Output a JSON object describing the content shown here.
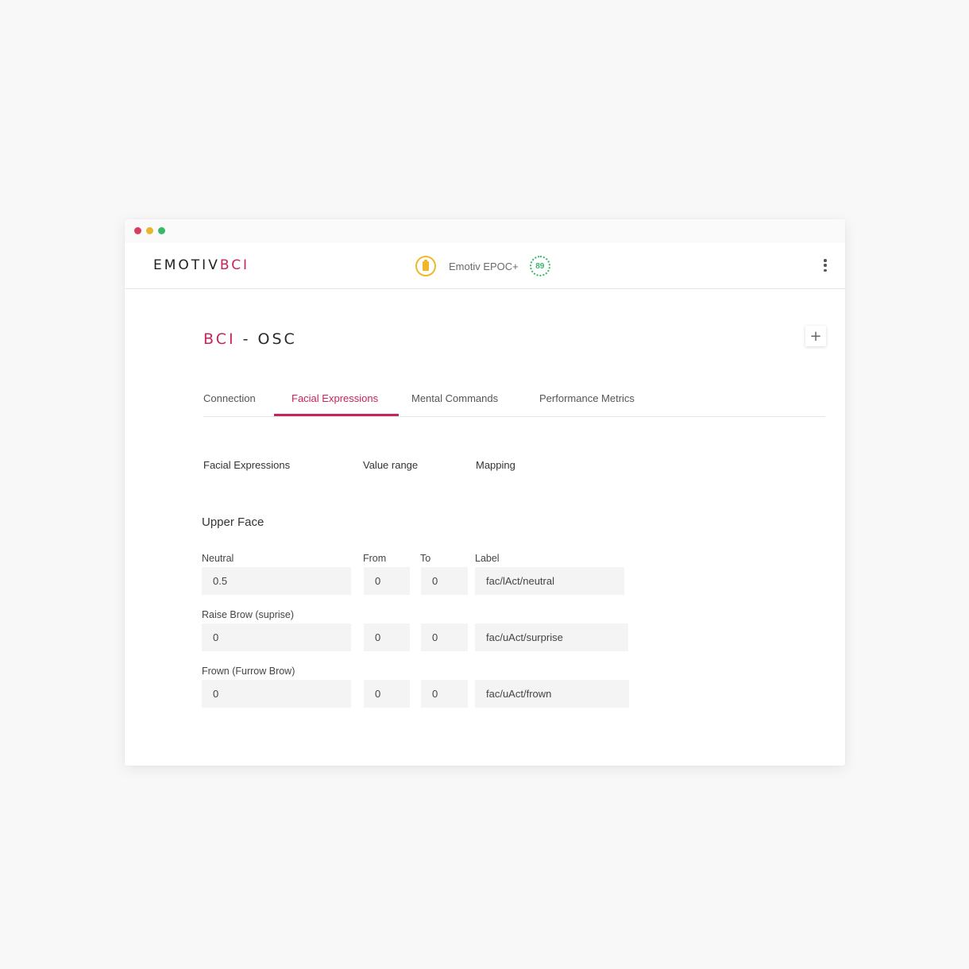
{
  "header": {
    "logo_main": "EMOTIV",
    "logo_accent": "BCI",
    "device_name": "Emotiv EPOC+",
    "signal_value": "89"
  },
  "page": {
    "title_accent": "BCI",
    "title_rest": " - OSC",
    "add_label": "+"
  },
  "tabs": [
    {
      "label": "Connection"
    },
    {
      "label": "Facial Expressions"
    },
    {
      "label": "Mental Commands"
    },
    {
      "label": "Performance Metrics"
    }
  ],
  "columns": {
    "expressions": "Facial Expressions",
    "value_range": "Value range",
    "mapping": "Mapping"
  },
  "section": {
    "title": "Upper Face",
    "from_label": "From",
    "to_label": "To",
    "label_label": "Label",
    "rows": [
      {
        "name": "Neutral",
        "value": "0.5",
        "from": "0",
        "to": "0",
        "label": "fac/lAct/neutral"
      },
      {
        "name": "Raise Brow (suprise)",
        "value": "0",
        "from": "0",
        "to": "0",
        "label": "fac/uAct/surprise"
      },
      {
        "name": "Frown (Furrow Brow)",
        "value": "0",
        "from": "0",
        "to": "0",
        "label": "fac/uAct/frown"
      }
    ]
  },
  "colors": {
    "accent": "#c8235c",
    "battery": "#f0b72b",
    "signal": "#3ab86a"
  }
}
